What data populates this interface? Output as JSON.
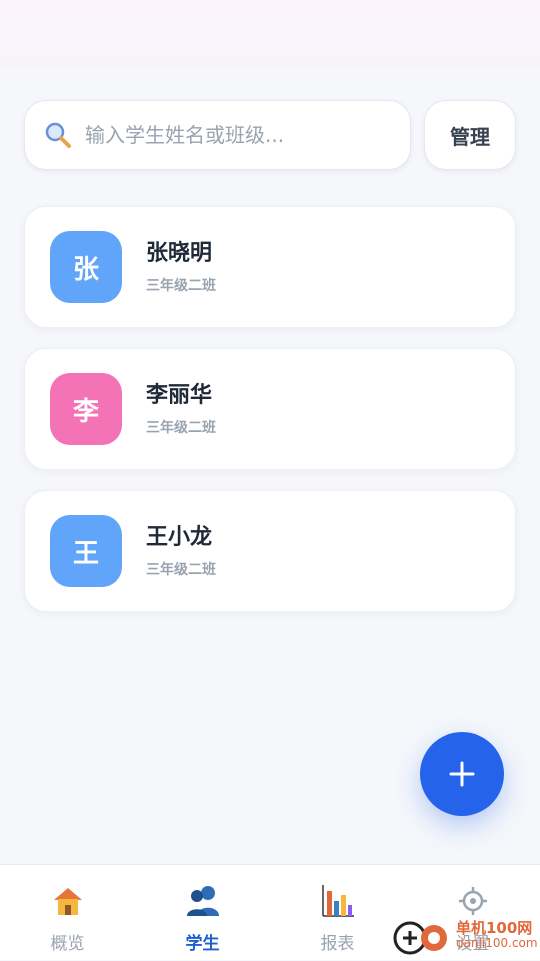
{
  "search": {
    "placeholder": "输入学生姓名或班级..."
  },
  "manage_label": "管理",
  "students": [
    {
      "avatar": "张",
      "name": "张晓明",
      "class": "三年级二班",
      "color": "#60a5fa"
    },
    {
      "avatar": "李",
      "name": "李丽华",
      "class": "三年级二班",
      "color": "#f472b6"
    },
    {
      "avatar": "王",
      "name": "王小龙",
      "class": "三年级二班",
      "color": "#60a5fa"
    }
  ],
  "fab_symbol": "+",
  "tabs": [
    {
      "label": "概览",
      "icon": "house-icon",
      "active": false
    },
    {
      "label": "学生",
      "icon": "people-icon",
      "active": true
    },
    {
      "label": "报表",
      "icon": "bar-chart-icon",
      "active": false
    },
    {
      "label": "设置",
      "icon": "gear-icon",
      "active": false
    }
  ],
  "watermark": {
    "text": "单机100网",
    "url": "danji100.com"
  },
  "colors": {
    "accent": "#2563eb",
    "active_tab": "#1d5fd1"
  }
}
